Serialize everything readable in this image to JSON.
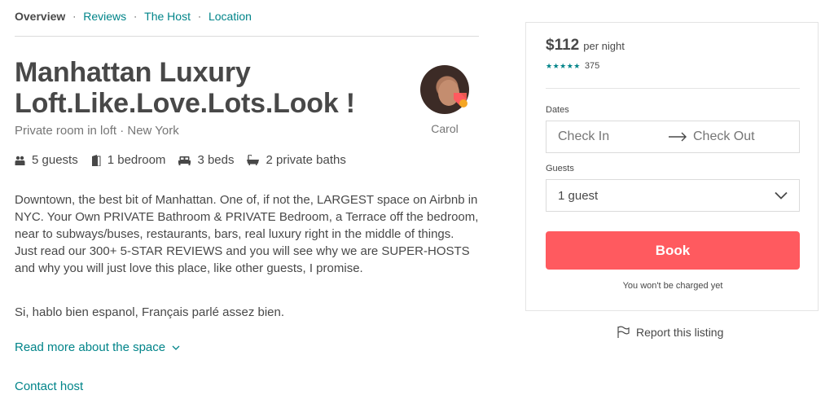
{
  "subnav": {
    "items": [
      "Overview",
      "Reviews",
      "The Host",
      "Location"
    ],
    "separator": "·"
  },
  "listing": {
    "title": "Manhattan Luxury Loft.Like.Love.Lots.Look !",
    "subtitle": "Private room in loft · New York",
    "host_name": "Carol",
    "amenities": [
      {
        "icon": "guests-icon",
        "label": "5 guests"
      },
      {
        "icon": "bedroom-icon",
        "label": "1 bedroom"
      },
      {
        "icon": "bed-icon",
        "label": "3 beds"
      },
      {
        "icon": "bath-icon",
        "label": "2 private baths"
      }
    ],
    "description": "Downtown, the best bit of Manhattan. One of, if not the, LARGEST space on Airbnb in NYC. Your Own PRIVATE Bathroom & PRIVATE Bedroom, a Terrace off the bedroom, near to subways/buses, restaurants, bars, real luxury right in the middle of things. Just read our 300+ 5-STAR REVIEWS and you will see why we are SUPER-HOSTS and why you will just love this place, like other guests, I promise.",
    "languages_note": "Si, hablo bien espanol, Français parlé assez bien.",
    "read_more": "Read more about the space",
    "contact_host": "Contact host"
  },
  "booking": {
    "price": "$112",
    "per_night": "per night",
    "stars": "★★★★★",
    "rating": 5,
    "review_count": "375",
    "dates_label": "Dates",
    "check_in_placeholder": "Check In",
    "check_out_placeholder": "Check Out",
    "guests_label": "Guests",
    "guests_value": "1 guest",
    "book_label": "Book",
    "note": "You won't be charged yet"
  },
  "report": {
    "label": "Report this listing"
  },
  "colors": {
    "accent": "#008489",
    "book_button": "#ff5a5f",
    "text": "#484848",
    "muted": "#767676"
  }
}
